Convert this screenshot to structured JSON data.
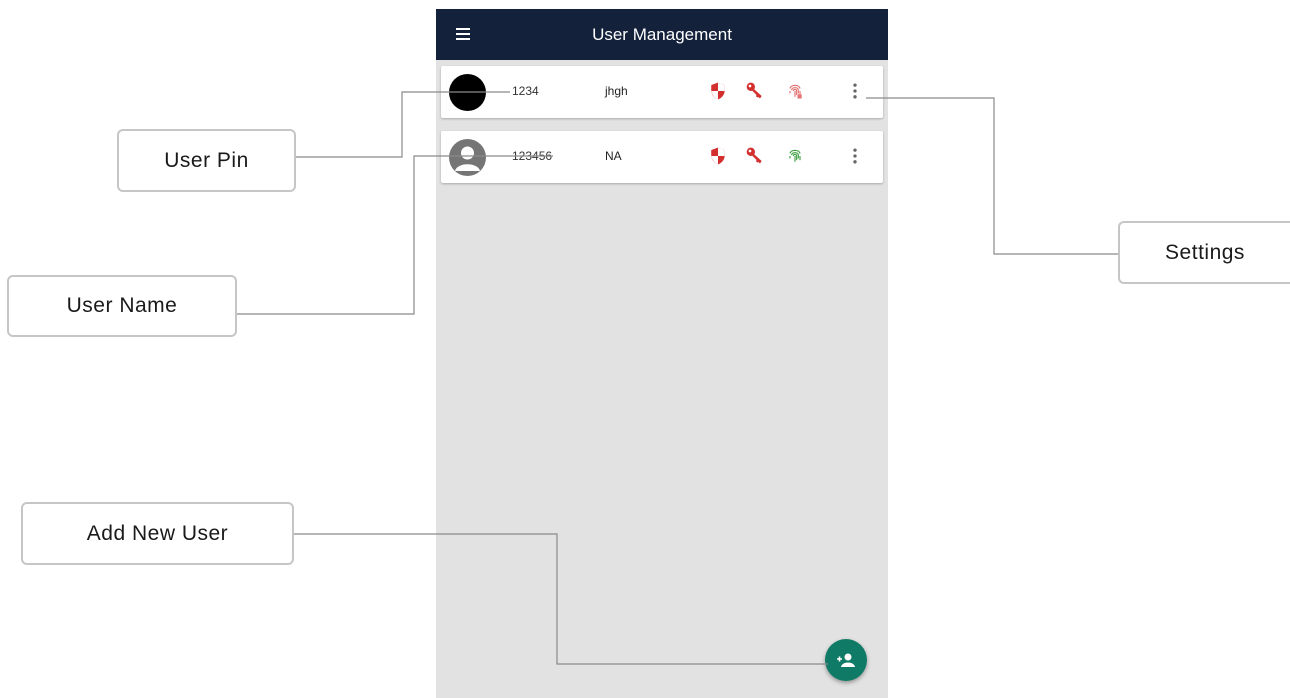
{
  "app": {
    "title": "User Management",
    "menu_icon": "hamburger-menu-icon"
  },
  "users": [
    {
      "pin": "1234",
      "name": "jhgh",
      "avatar": "black-filled-avatar",
      "fingerprint_color": "#e57373"
    },
    {
      "pin": "123456",
      "name": "NA",
      "avatar": "default-person-avatar",
      "fingerprint_color": "#43a047"
    }
  ],
  "row_icons": [
    "shield-icon",
    "key-icon",
    "fingerprint-icon",
    "more-vert-icon"
  ],
  "fab": {
    "icon": "add-person-icon",
    "color": "#0f7a66"
  },
  "callouts": {
    "user_pin": "User Pin",
    "user_name": "User Name",
    "settings": "Settings",
    "add_new_user": "Add New User"
  },
  "colors": {
    "app_bar": "#13213b",
    "icon_red": "#d32f2f",
    "background": "#e2e2e2"
  }
}
